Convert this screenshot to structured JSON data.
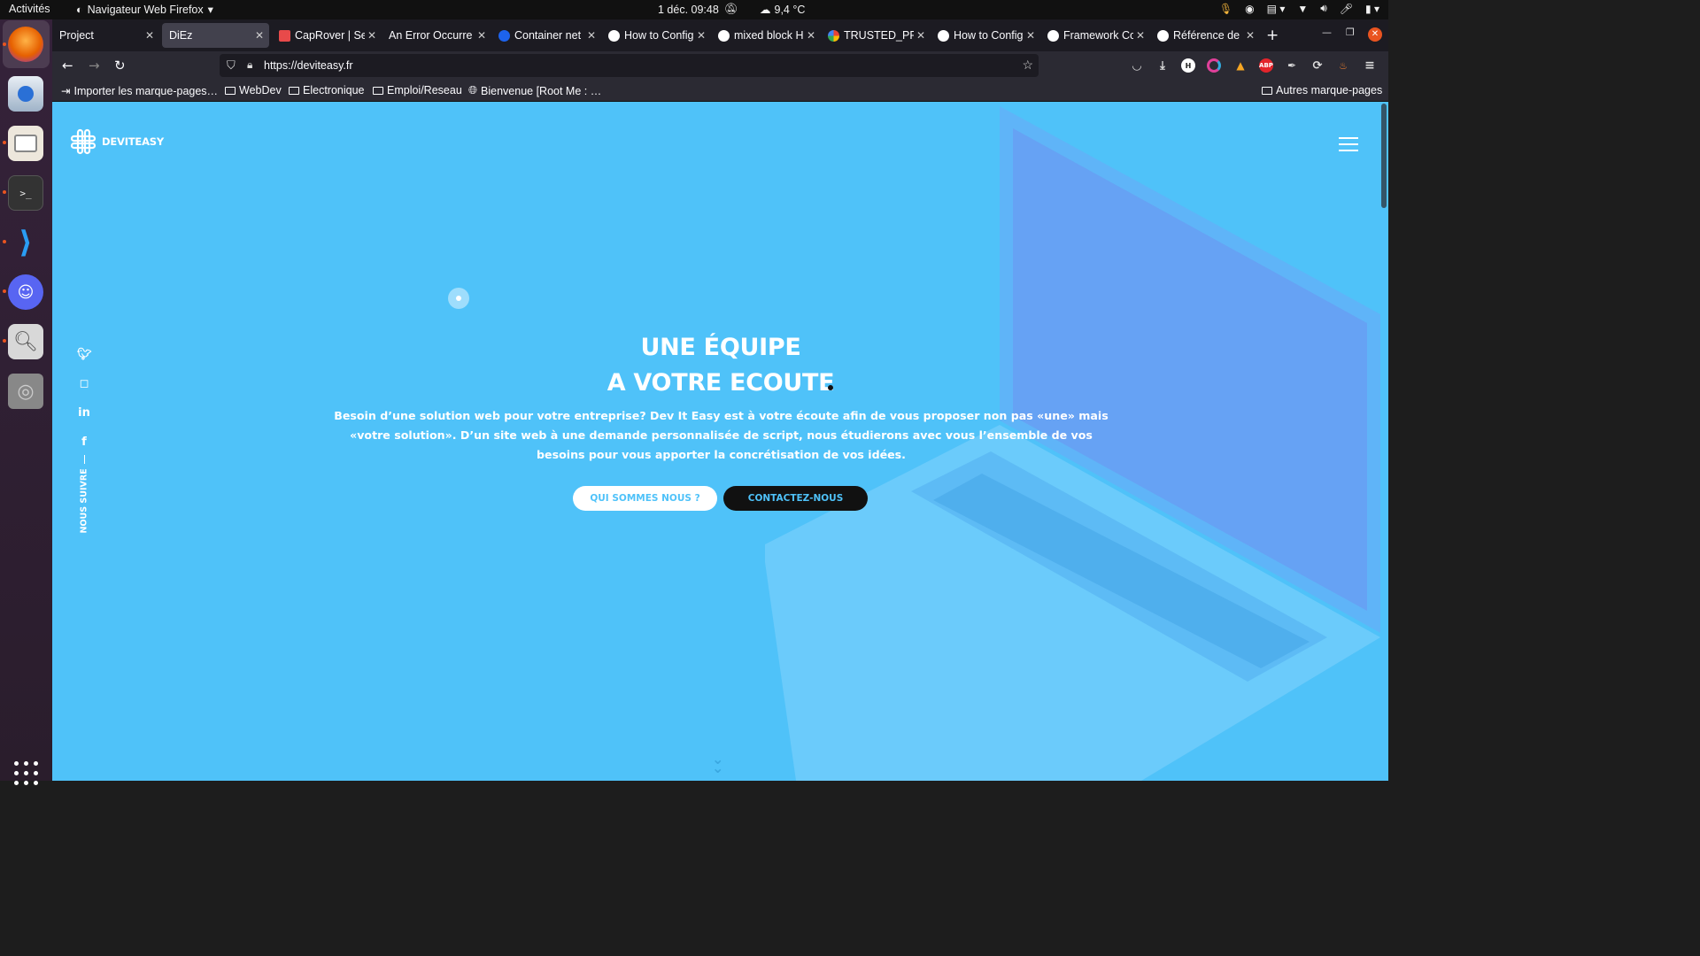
{
  "system": {
    "activities": "Activités",
    "app_menu": "Navigateur Web Firefox",
    "clock": "1 déc.  09:48",
    "weather": "9,4 °C"
  },
  "tabs": [
    {
      "title": "Project",
      "icon": "none"
    },
    {
      "title": "DiEz",
      "icon": "none"
    },
    {
      "title": "CapRover | Se",
      "icon": "caprover-icon"
    },
    {
      "title": "An Error Occurre",
      "icon": "none"
    },
    {
      "title": "Container net",
      "icon": "docker-icon"
    },
    {
      "title": "How to Config",
      "icon": "symfony-icon"
    },
    {
      "title": "mixed block H",
      "icon": "github-icon"
    },
    {
      "title": "TRUSTED_PRO",
      "icon": "google-icon"
    },
    {
      "title": "How to Config",
      "icon": "symfony-icon"
    },
    {
      "title": "Framework Co",
      "icon": "symfony-icon"
    },
    {
      "title": "Référence de",
      "icon": "symfony-icon"
    }
  ],
  "url": "https://deviteasy.fr",
  "bookmarks": {
    "import": "Importer les marque-pages…",
    "items": [
      "WebDev",
      "Electronique",
      "Emploi/Reseau",
      "Bienvenue [Root Me : …"
    ],
    "other": "Autres marque-pages"
  },
  "site": {
    "logo": "DEVITEASY",
    "title_line1": "UNE ÉQUIPE",
    "title_line2": "A VOTRE ECOUTE",
    "paragraph": "Besoin d’une solution web pour votre entreprise? Dev It Easy est à votre écoute afin de vous proposer non pas «une» mais «votre solution». D’un site web à une demande personnalisée de script, nous étudierons avec vous l’ensemble de vos besoins pour vous apporter la concrétisation de vos idées.",
    "btn_about": "QUI SOMMES NOUS ?",
    "btn_contact": "CONTACTEZ-NOUS",
    "follow": "NOUS SUIVRE",
    "social": [
      "twitter-icon",
      "instagram-icon",
      "linkedin-icon",
      "facebook-icon"
    ]
  },
  "colors": {
    "page_bg": "#4fc2f9",
    "accent": "#e95420"
  }
}
